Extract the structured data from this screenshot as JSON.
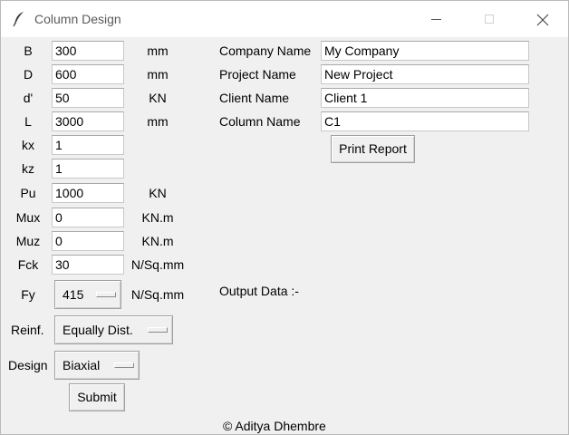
{
  "window": {
    "title": "Column Design",
    "controls": [
      "minimize-icon",
      "maximize-icon",
      "close-icon"
    ]
  },
  "inputs": [
    {
      "label": "B",
      "value": "300",
      "unit": "mm"
    },
    {
      "label": "D",
      "value": "600",
      "unit": "mm"
    },
    {
      "label": "d'",
      "value": "50",
      "unit": "KN"
    },
    {
      "label": "L",
      "value": "3000",
      "unit": "mm"
    },
    {
      "label": "kx",
      "value": "1",
      "unit": ""
    },
    {
      "label": "kz",
      "value": "1",
      "unit": ""
    },
    {
      "label": "Pu",
      "value": "1000",
      "unit": "KN"
    },
    {
      "label": "Mux",
      "value": "0",
      "unit": "KN.m"
    },
    {
      "label": "Muz",
      "value": "0",
      "unit": "KN.m"
    },
    {
      "label": "Fck",
      "value": "30",
      "unit": "N/Sq.mm"
    }
  ],
  "fy": {
    "label": "Fy",
    "value": "415",
    "unit": "N/Sq.mm"
  },
  "reinf": {
    "label": "Reinf.",
    "value": "Equally Dist."
  },
  "design": {
    "label": "Design",
    "value": "Biaxial"
  },
  "submit_label": "Submit",
  "report": {
    "company_label": "Company Name",
    "company_value": "My Company",
    "project_label": "Project Name",
    "project_value": "New Project",
    "client_label": "Client Name",
    "client_value": "Client 1",
    "column_label": "Column Name",
    "column_value": "C1",
    "print_label": "Print Report"
  },
  "output_label": "Output Data :-",
  "footer": "© Aditya Dhembre"
}
